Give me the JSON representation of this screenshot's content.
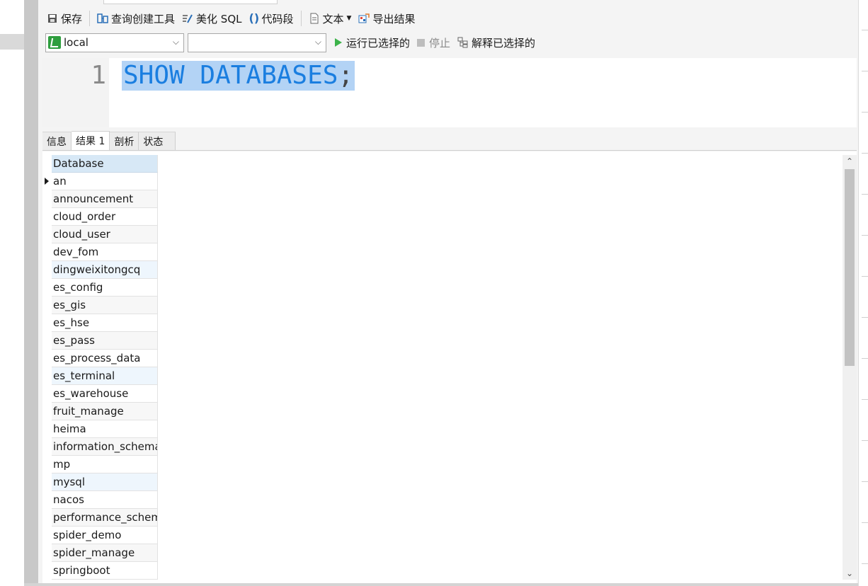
{
  "toolbar": {
    "save": "保存",
    "query_builder": "查询创建工具",
    "beautify": "美化 SQL",
    "snippet": "代码段",
    "text": "文本",
    "export": "导出结果"
  },
  "connection": {
    "connection_value": "local",
    "database_value": "",
    "run_selected": "运行已选择的",
    "stop": "停止",
    "explain_selected": "解释已选择的"
  },
  "editor": {
    "line_number": "1",
    "keyword1": "SHOW",
    "keyword2": "DATABASES",
    "terminator": ";"
  },
  "result_tabs": [
    "信息",
    "结果 1",
    "剖析",
    "状态"
  ],
  "active_result_tab": "结果 1",
  "grid": {
    "column_header": "Database",
    "rows": [
      "an",
      "announcement",
      "cloud_order",
      "cloud_user",
      "dev_fom",
      "dingweixitongcq",
      "es_config",
      "es_gis",
      "es_hse",
      "es_pass",
      "es_process_data",
      "es_terminal",
      "es_warehouse",
      "fruit_manage",
      "heima",
      "information_schema",
      "mp",
      "mysql",
      "nacos",
      "performance_schem",
      "spider_demo",
      "spider_manage",
      "springboot"
    ]
  },
  "icons": {
    "save": "floppy-icon",
    "query_builder": "query-builder-icon",
    "beautify": "beautify-icon",
    "snippet": "braces-icon",
    "text": "document-icon",
    "export": "export-icon",
    "run": "play-icon",
    "stop": "stop-icon",
    "explain": "explain-icon"
  },
  "colors": {
    "keyword": "#1a7ee0",
    "selection": "#b3d3f5",
    "run_green": "#3cb34a",
    "grid_header": "#d7e8f6"
  }
}
